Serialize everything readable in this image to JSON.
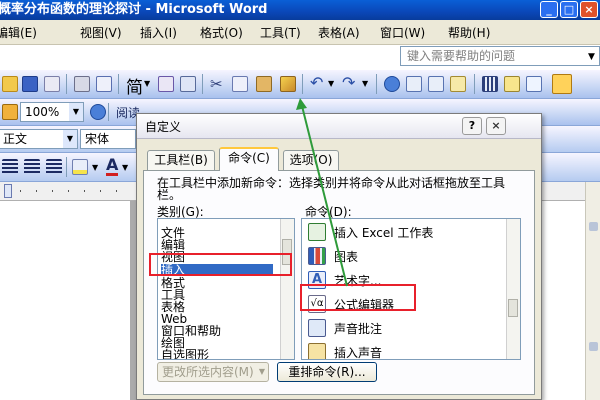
{
  "window": {
    "title": "概率分布函数的理论探讨 - Microsoft Word"
  },
  "menubar": {
    "items": [
      "编辑(E)",
      "视图(V)",
      "插入(I)",
      "格式(O)",
      "工具(T)",
      "表格(A)",
      "窗口(W)",
      "帮助(H)"
    ],
    "help_placeholder": "键入需要帮助的问题"
  },
  "toolbar": {
    "simplify_label": "简",
    "zoom": "100%",
    "reading_label": "阅读",
    "style": "正文",
    "font": "宋体"
  },
  "dialog": {
    "title": "自定义",
    "tabs": [
      "工具栏(B)",
      "命令(C)",
      "选项(O)"
    ],
    "active_tab": 1,
    "instruction": "在工具栏中添加新命令：选择类别并将命令从此对话框拖放至工具栏。",
    "categories_label": "类别(G):",
    "commands_label": "命令(D):",
    "categories": [
      "文件",
      "编辑",
      "视图",
      "插入",
      "格式",
      "工具",
      "表格",
      "Web",
      "窗口和帮助",
      "绘图",
      "自选图形"
    ],
    "selected_category": "插入",
    "commands": [
      {
        "icon": "excel-worksheet-icon",
        "label": "插入 Excel 工作表"
      },
      {
        "icon": "chart-icon",
        "label": "图表"
      },
      {
        "icon": "wordart-icon",
        "label": "艺术字..."
      },
      {
        "icon": "equation-editor-icon",
        "label": "公式编辑器"
      },
      {
        "icon": "sound-comment-icon",
        "label": "声音批注"
      },
      {
        "icon": "insert-sound-icon",
        "label": "插入声音"
      }
    ],
    "modify_button": "更改所选内容(M)",
    "rearrange_button": "重排命令(R)..."
  },
  "colors": {
    "highlight": "#e8202b",
    "arrow": "#2e9b3a",
    "selection": "#316ac5"
  }
}
